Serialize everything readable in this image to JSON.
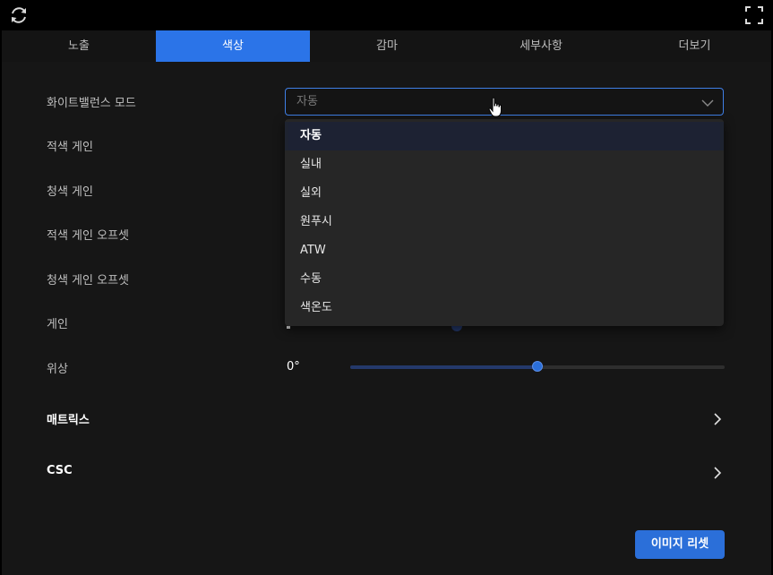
{
  "icons": {
    "refresh": "refresh-icon",
    "fullscreen": "fullscreen-icon",
    "chevron_down": "chevron-down-icon",
    "chevron_right": "chevron-right-icon",
    "cursor": "hand-pointer-icon"
  },
  "colors": {
    "accent": "#2b74e8",
    "background": "#161616",
    "dropdown_bg": "#262626",
    "text_muted": "#bfbfbf"
  },
  "tabs": [
    {
      "label": "노출",
      "active": false
    },
    {
      "label": "색상",
      "active": true
    },
    {
      "label": "감마",
      "active": false
    },
    {
      "label": "세부사항",
      "active": false
    },
    {
      "label": "더보기",
      "active": false
    }
  ],
  "settings": {
    "white_balance_label": "화이트밸런스 모드",
    "red_gain_label": "적색 게인",
    "blue_gain_label": "청색 게인",
    "red_gain_offset_label": "적색 게인 오프셋",
    "blue_gain_offset_label": "청색 게인 오프셋",
    "gain_label": "게인",
    "phase_label": "위상",
    "matrix_label": "매트릭스",
    "csc_label": "CSC"
  },
  "white_balance_select": {
    "value": "자동",
    "options": [
      "자동",
      "실내",
      "실외",
      "원푸시",
      "ATW",
      "수동",
      "색온도"
    ],
    "selected_index": 0
  },
  "phase_slider": {
    "value_text": "0°",
    "fraction": 0.5
  },
  "reset_button_label": "이미지 리셋"
}
